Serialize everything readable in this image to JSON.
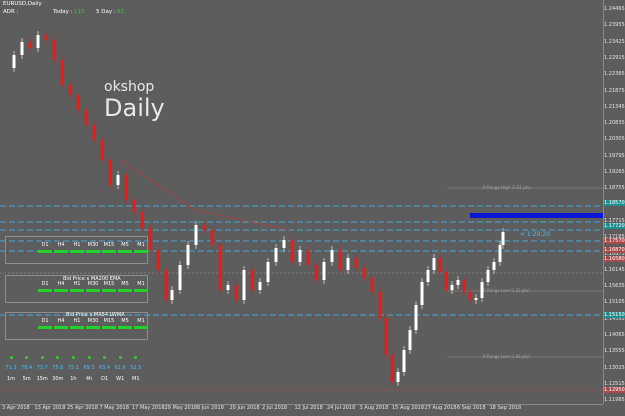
{
  "header": {
    "symbol": "EURUSD,Daily",
    "adr_label": "ADR :",
    "adr_value": "",
    "today_label": "Today :",
    "today_value": "115",
    "fiveday_label": "5 Day :",
    "fiveday_value": "82"
  },
  "watermark": {
    "line1": "okshop",
    "line2": "Daily"
  },
  "timer_text": "< 1:20:20",
  "price_axis_labels": [
    "1.24465",
    "1.23955",
    "1.23425",
    "1.22915",
    "1.22385",
    "1.21875",
    "1.21345",
    "1.20835",
    "1.20305",
    "1.19795",
    "1.19265",
    "1.18755",
    "1.18225",
    "1.17715",
    "1.17185",
    "1.16675",
    "1.16145",
    "1.15635",
    "1.15105",
    "1.14595",
    "1.14065",
    "1.13555",
    "1.13025",
    "1.12515",
    "1.11985"
  ],
  "price_tags": [
    {
      "text": "1.18570",
      "color": "#1f8f8f"
    },
    {
      "text": "1.17720",
      "color": "#1f8f8f"
    },
    {
      "text": "1.17570",
      "color": "#a94a4a"
    },
    {
      "text": "1.16870",
      "color": "#a94a4a"
    },
    {
      "text": "1.16580",
      "color": "#a94a4a"
    },
    {
      "text": "1.15150",
      "color": "#1f8f8f"
    },
    {
      "text": "1.12950",
      "color": "#a94a4a"
    }
  ],
  "date_labels": [
    "3 Apr 2018",
    "13 Apr 2018",
    "25 Apr 2018",
    "7 May 2018",
    "17 May 2018",
    "29 May 2018",
    "8 Jun 2018",
    "20 Jun 2018",
    "2 Jul 2018",
    "12 Jul 2018",
    "24 Jul 2018",
    "3 Aug 2018",
    "15 Aug 2018",
    "27 Aug 2018",
    "6 Sep 2018",
    "18 Sep 2018"
  ],
  "range_labels": {
    "high": "R Range High (1.61 pts)",
    "low": "R Range Low (1.33 pts)",
    "low2": "R Range Low (1.88 pts)"
  },
  "panels": {
    "timeframes": [
      "D1",
      "H4",
      "H1",
      "M30",
      "M15",
      "M5",
      "M1"
    ],
    "panel2_title": "Bid  Price  x  MA200 EMA",
    "panel3_title": "Bid  Price  x  MA54 LWMA"
  },
  "rsi": {
    "values": [
      "71.3",
      "78.4",
      "73.7",
      "75.6",
      "75.1",
      "69.3",
      "63.4",
      "61.9",
      "52.5"
    ],
    "timeframes": [
      "1m",
      "5m",
      "15m",
      "30m",
      "1h",
      "4h",
      "D1",
      "W1",
      "M1"
    ]
  },
  "colors": {
    "background": "#5d5d5d",
    "bull": "#ffffff",
    "bear": "#e0201c",
    "ok_bar": "#22d12a",
    "level_line": "#3ec4ff",
    "blue_zone": "#0a16d8"
  }
}
